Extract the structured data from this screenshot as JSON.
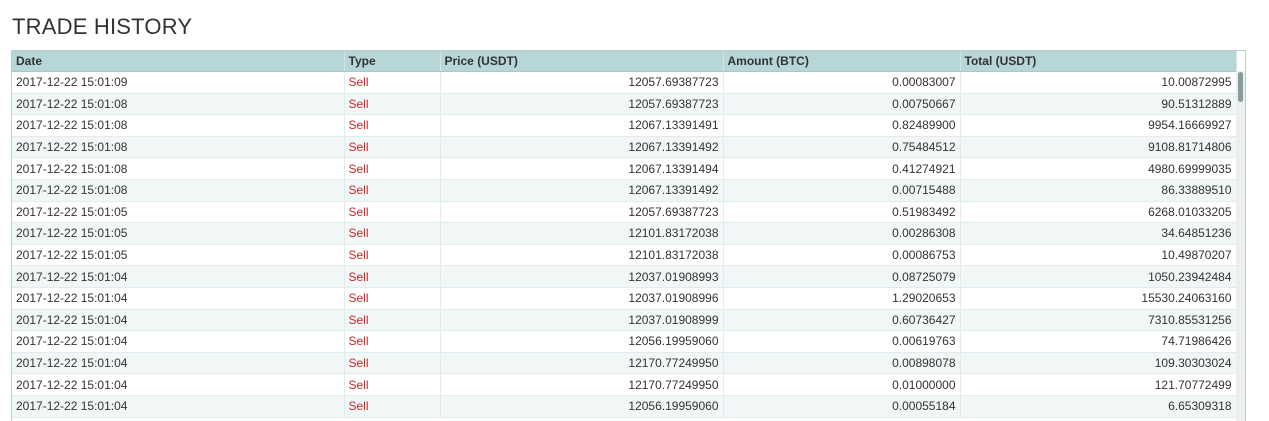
{
  "page": {
    "title": "TRADE HISTORY"
  },
  "colors": {
    "header_bg": "#b6d6d8",
    "row_alt_bg": "#f1f6f6",
    "sell_color": "#c62828"
  },
  "table": {
    "columns": [
      "Date",
      "Type",
      "Price (USDT)",
      "Amount (BTC)",
      "Total (USDT)"
    ],
    "rows": [
      [
        "2017-12-22 15:01:09",
        "Sell",
        "12057.69387723",
        "0.00083007",
        "10.00872995"
      ],
      [
        "2017-12-22 15:01:08",
        "Sell",
        "12057.69387723",
        "0.00750667",
        "90.51312889"
      ],
      [
        "2017-12-22 15:01:08",
        "Sell",
        "12067.13391491",
        "0.82489900",
        "9954.16669927"
      ],
      [
        "2017-12-22 15:01:08",
        "Sell",
        "12067.13391492",
        "0.75484512",
        "9108.81714806"
      ],
      [
        "2017-12-22 15:01:08",
        "Sell",
        "12067.13391494",
        "0.41274921",
        "4980.69999035"
      ],
      [
        "2017-12-22 15:01:08",
        "Sell",
        "12067.13391492",
        "0.00715488",
        "86.33889510"
      ],
      [
        "2017-12-22 15:01:05",
        "Sell",
        "12057.69387723",
        "0.51983492",
        "6268.01033205"
      ],
      [
        "2017-12-22 15:01:05",
        "Sell",
        "12101.83172038",
        "0.00286308",
        "34.64851236"
      ],
      [
        "2017-12-22 15:01:05",
        "Sell",
        "12101.83172038",
        "0.00086753",
        "10.49870207"
      ],
      [
        "2017-12-22 15:01:04",
        "Sell",
        "12037.01908993",
        "0.08725079",
        "1050.23942484"
      ],
      [
        "2017-12-22 15:01:04",
        "Sell",
        "12037.01908996",
        "1.29020653",
        "15530.24063160"
      ],
      [
        "2017-12-22 15:01:04",
        "Sell",
        "12037.01908999",
        "0.60736427",
        "7310.85531256"
      ],
      [
        "2017-12-22 15:01:04",
        "Sell",
        "12056.19959060",
        "0.00619763",
        "74.71986426"
      ],
      [
        "2017-12-22 15:01:04",
        "Sell",
        "12170.77249950",
        "0.00898078",
        "109.30303024"
      ],
      [
        "2017-12-22 15:01:04",
        "Sell",
        "12170.77249950",
        "0.01000000",
        "121.70772499"
      ],
      [
        "2017-12-22 15:01:04",
        "Sell",
        "12056.19959060",
        "0.00055184",
        "6.65309318"
      ]
    ]
  }
}
